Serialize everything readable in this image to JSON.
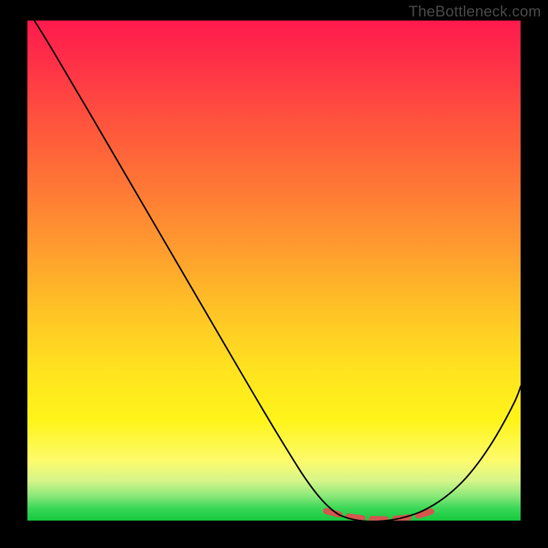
{
  "watermark": "TheBottleneck.com",
  "chart_data": {
    "type": "line",
    "title": "",
    "xlabel": "",
    "ylabel": "",
    "xlim": [
      0,
      100
    ],
    "ylim": [
      0,
      100
    ],
    "x": [
      0,
      5,
      10,
      15,
      20,
      25,
      30,
      35,
      40,
      45,
      50,
      55,
      60,
      63,
      66,
      70,
      74,
      78,
      82,
      86,
      90,
      95,
      100
    ],
    "values": [
      100,
      97,
      91,
      84,
      77,
      70,
      63,
      56,
      49,
      42,
      35,
      27,
      18,
      11,
      6,
      2,
      0.5,
      0,
      1,
      4,
      10,
      20,
      33
    ],
    "dotted_region_x": [
      62,
      82
    ],
    "note": "Values approximate percentage height of the curve read from the plot. Background encodes value by hue: red≈100 (top) → green≈0 (bottom). Optimal (minimum) around x≈76–78."
  }
}
